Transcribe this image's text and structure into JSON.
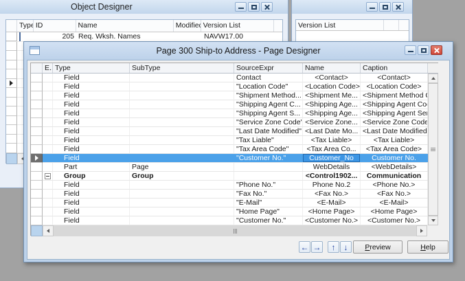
{
  "desktop": {
    "background": "#a2a2a2"
  },
  "colors": {
    "selection_blue": "#4ba1e9",
    "titlebar_blue": "#c2d6ec",
    "close_button_red": "#cf4638",
    "window_body": "#e9eff8"
  },
  "object_designer": {
    "title": "Object Designer",
    "window_buttons": [
      "minimize-icon",
      "maximize-icon",
      "close-icon"
    ],
    "columns": {
      "type": "Type",
      "id": "ID",
      "name": "Name",
      "modified": "Modified",
      "version_list": "Version List"
    },
    "visible_row": {
      "type_icon": "table-icon",
      "id": "205",
      "name": "Req. Wksh. Names",
      "modified": "",
      "version_list": "NAVW17.00"
    },
    "current_row_marker": "right-triangle-icon"
  },
  "secondary_window": {
    "title": "",
    "window_buttons": [
      "minimize-icon",
      "maximize-icon",
      "close-icon"
    ],
    "columns": {
      "version_list": "Version List"
    }
  },
  "page_designer": {
    "title": "Page 300 Ship-to Address - Page Designer",
    "title_icon": "form-icon",
    "window_buttons": [
      "minimize-icon",
      "maximize-icon",
      "close-icon"
    ],
    "columns": {
      "expand": "E..",
      "type": "Type",
      "subtype": "SubType",
      "source_expr": "SourceExpr",
      "name": "Name",
      "caption": "Caption"
    },
    "rows": [
      {
        "type": "Field",
        "subtype": "",
        "source_expr": "Contact",
        "name": "<Contact>",
        "caption": "<Contact>"
      },
      {
        "type": "Field",
        "subtype": "",
        "source_expr": "\"Location Code\"",
        "name": "<Location Code>",
        "caption": "<Location Code>"
      },
      {
        "type": "Field",
        "subtype": "",
        "source_expr": "\"Shipment Method...",
        "name": "<Shipment Me...",
        "caption": "<Shipment Method Code>"
      },
      {
        "type": "Field",
        "subtype": "",
        "source_expr": "\"Shipping Agent C...",
        "name": "<Shipping Age...",
        "caption": "<Shipping Agent Code>"
      },
      {
        "type": "Field",
        "subtype": "",
        "source_expr": "\"Shipping Agent S...",
        "name": "<Shipping Age...",
        "caption": "<Shipping Agent Service C.."
      },
      {
        "type": "Field",
        "subtype": "",
        "source_expr": "\"Service Zone Code\"",
        "name": "<Service Zone...",
        "caption": "<Service Zone Code>"
      },
      {
        "type": "Field",
        "subtype": "",
        "source_expr": "\"Last Date Modified\"",
        "name": "<Last Date Mo...",
        "caption": "<Last Date Modified>"
      },
      {
        "type": "Field",
        "subtype": "",
        "source_expr": "\"Tax Liable\"",
        "name": "<Tax Liable>",
        "caption": "<Tax Liable>"
      },
      {
        "type": "Field",
        "subtype": "",
        "source_expr": "\"Tax Area Code\"",
        "name": "<Tax Area Co...",
        "caption": "<Tax Area Code>"
      },
      {
        "type": "Field",
        "subtype": "",
        "source_expr": "\"Customer No.\"",
        "name": "Customer_No",
        "caption": "Customer No.",
        "selected": true
      },
      {
        "type": "Part",
        "subtype": "Page",
        "source_expr": "",
        "name": "WebDetails",
        "caption": "<WebDetails>"
      },
      {
        "type": "Group",
        "subtype": "Group",
        "source_expr": "",
        "name": "<Control1902...",
        "caption": "Communication",
        "bold": true,
        "expander": true
      },
      {
        "type": "Field",
        "subtype": "",
        "source_expr": "\"Phone No.\"",
        "name": "Phone No.2",
        "caption": "<Phone No.>"
      },
      {
        "type": "Field",
        "subtype": "",
        "source_expr": "\"Fax No.\"",
        "name": "<Fax No.>",
        "caption": "<Fax No.>"
      },
      {
        "type": "Field",
        "subtype": "",
        "source_expr": "\"E-Mail\"",
        "name": "<E-Mail>",
        "caption": "<E-Mail>"
      },
      {
        "type": "Field",
        "subtype": "",
        "source_expr": "\"Home Page\"",
        "name": "<Home Page>",
        "caption": "<Home Page>"
      },
      {
        "type": "Field",
        "subtype": "",
        "source_expr": "\"Customer No.\"",
        "name": "<Customer No.>",
        "caption": "<Customer No.>"
      }
    ],
    "footer_buttons": {
      "left": "←",
      "right": "→",
      "up": "↑",
      "down": "↓",
      "preview": "Preview",
      "help": "Help"
    },
    "scrollbar_icons": [
      "up-arrow-icon",
      "down-arrow-icon",
      "left-arrow-icon",
      "right-arrow-icon",
      "grip-icon"
    ]
  }
}
